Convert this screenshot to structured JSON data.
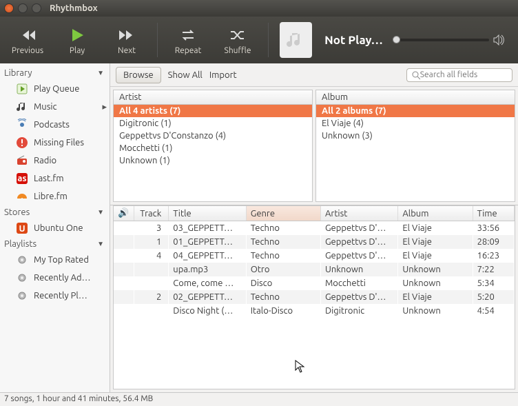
{
  "window": {
    "title": "Rhythmbox"
  },
  "toolbar": {
    "previous": "Previous",
    "play": "Play",
    "next": "Next",
    "repeat": "Repeat",
    "shuffle": "Shuffle",
    "nowplaying": "Not Play…"
  },
  "browsebar": {
    "browse": "Browse",
    "showall": "Show All",
    "import": "Import",
    "search_placeholder": "Search all fields"
  },
  "sidebar": {
    "library_label": "Library",
    "stores_label": "Stores",
    "playlists_label": "Playlists",
    "library": [
      {
        "label": "Play Queue"
      },
      {
        "label": "Music"
      },
      {
        "label": "Podcasts"
      },
      {
        "label": "Missing Files"
      },
      {
        "label": "Radio"
      },
      {
        "label": "Last.fm"
      },
      {
        "label": "Libre.fm"
      }
    ],
    "stores": [
      {
        "label": "Ubuntu One"
      }
    ],
    "playlists": [
      {
        "label": "My Top Rated"
      },
      {
        "label": "Recently Ad…"
      },
      {
        "label": "Recently Pl…"
      }
    ]
  },
  "browser": {
    "artist_header": "Artist",
    "album_header": "Album",
    "artists": [
      {
        "label": "All 4 artists (7)",
        "selected": true
      },
      {
        "label": "Digitronic (1)"
      },
      {
        "label": "Geppettvs D'Constanzo (4)"
      },
      {
        "label": "Mocchetti (1)"
      },
      {
        "label": "Unknown (1)"
      }
    ],
    "albums": [
      {
        "label": "All 2 albums (7)",
        "selected": true
      },
      {
        "label": "El Viaje (4)"
      },
      {
        "label": "Unknown (3)"
      }
    ]
  },
  "table": {
    "headers": {
      "play": "🔊",
      "track": "Track",
      "title": "Title",
      "genre": "Genre",
      "artist": "Artist",
      "album": "Album",
      "time": "Time"
    },
    "rows": [
      {
        "track": "3",
        "title": "03_GEPPETT…",
        "genre": "Techno",
        "artist": "Geppettvs D'…",
        "album": "El Viaje",
        "time": "33:56"
      },
      {
        "track": "1",
        "title": "01_GEPPETT…",
        "genre": "Techno",
        "artist": "Geppettvs D'…",
        "album": "El Viaje",
        "time": "28:09"
      },
      {
        "track": "4",
        "title": "04_GEPPETT…",
        "genre": "Techno",
        "artist": "Geppettvs D'…",
        "album": "El Viaje",
        "time": "16:23"
      },
      {
        "track": "",
        "title": "upa.mp3",
        "genre": "Otro",
        "artist": "Unknown",
        "album": "Unknown",
        "time": "7:22"
      },
      {
        "track": "",
        "title": "Come, come …",
        "genre": "Disco",
        "artist": "Mocchetti",
        "album": "Unknown",
        "time": "5:34"
      },
      {
        "track": "2",
        "title": "02_GEPPETT…",
        "genre": "Techno",
        "artist": "Geppettvs D'…",
        "album": "El Viaje",
        "time": "5:20"
      },
      {
        "track": "",
        "title": "Disco Night (…",
        "genre": "Italo-Disco",
        "artist": "Digitronic",
        "album": "Unknown",
        "time": "4:54"
      }
    ]
  },
  "status": "7 songs, 1 hour and 41 minutes, 56.4 MB"
}
